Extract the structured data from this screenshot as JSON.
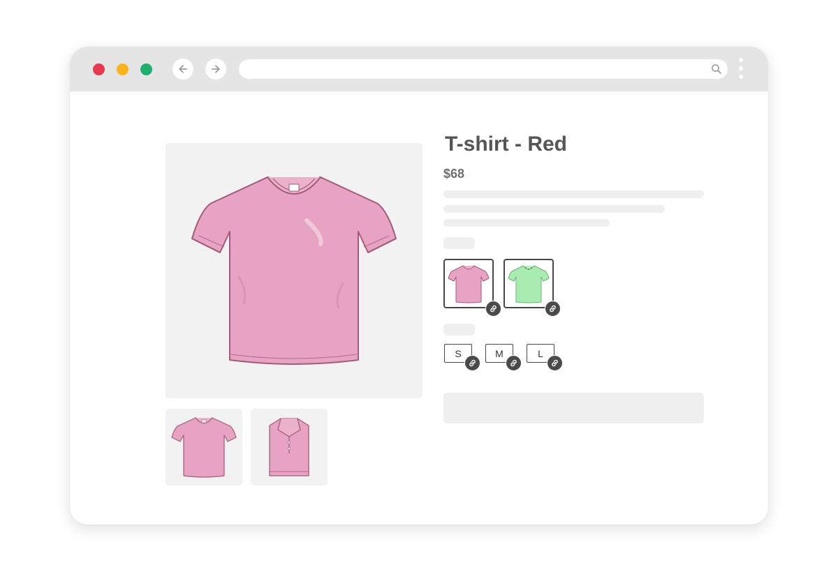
{
  "colors": {
    "toolbar": "#e5e5e5",
    "close_dot": "#e8384f",
    "minimize_dot": "#fbb41a",
    "maximize_dot": "#1fae6e",
    "shirt_pink": "#e7a3c2",
    "shirt_green": "#a8ecb1",
    "placeholder": "#efefef"
  },
  "browser": {
    "address_value": "",
    "icons": [
      "arrow-left-icon",
      "arrow-right-icon",
      "search-icon",
      "kebab-menu-icon"
    ]
  },
  "product": {
    "title": "T-shirt - Red",
    "price": "$68",
    "color_options": [
      {
        "icon": "pink-tshirt-icon",
        "badge": "link-icon",
        "selected": true
      },
      {
        "icon": "green-tshirt-icon",
        "badge": "link-icon",
        "selected": false
      }
    ],
    "sizes": [
      {
        "label": "S",
        "badge": "link-icon"
      },
      {
        "label": "M",
        "badge": "link-icon"
      },
      {
        "label": "L",
        "badge": "link-icon"
      }
    ]
  },
  "gallery": {
    "main": "pink-tshirt-front",
    "thumbnails": [
      "pink-tshirt-front",
      "pink-polo-folded"
    ]
  }
}
